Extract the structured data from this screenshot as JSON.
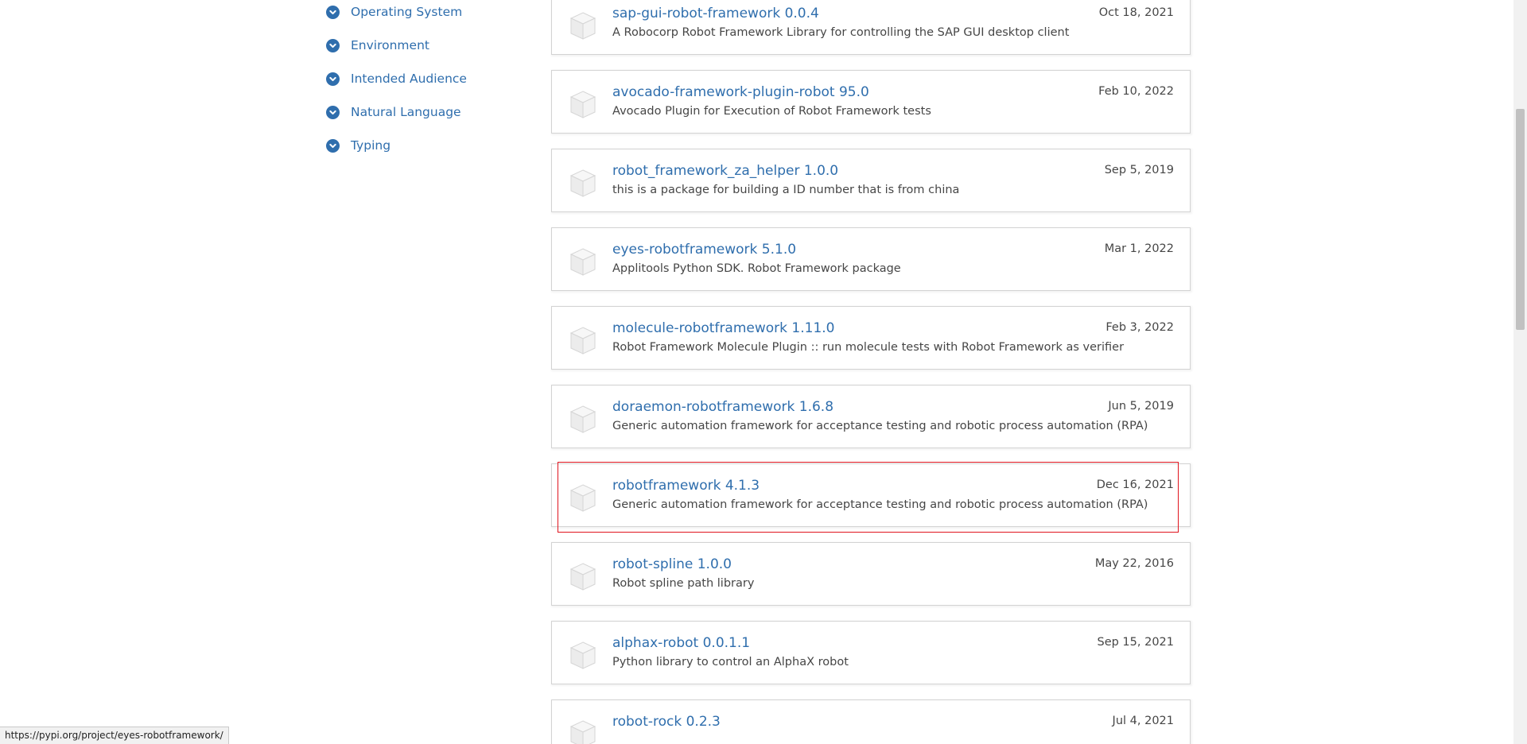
{
  "filters": [
    {
      "label": "Operating System",
      "icon": "chevron-down-circle-icon"
    },
    {
      "label": "Environment",
      "icon": "chevron-down-circle-icon"
    },
    {
      "label": "Intended Audience",
      "icon": "chevron-down-circle-icon"
    },
    {
      "label": "Natural Language",
      "icon": "chevron-down-circle-icon"
    },
    {
      "label": "Typing",
      "icon": "chevron-down-circle-icon"
    }
  ],
  "packages": [
    {
      "name": "sap-gui-robot-framework 0.0.4",
      "description": "A Robocorp Robot Framework Library for controlling the SAP GUI desktop client",
      "date": "Oct 18, 2021"
    },
    {
      "name": "avocado-framework-plugin-robot 95.0",
      "description": "Avocado Plugin for Execution of Robot Framework tests",
      "date": "Feb 10, 2022"
    },
    {
      "name": "robot_framework_za_helper 1.0.0",
      "description": "this is a package for building a ID number that is from china",
      "date": "Sep 5, 2019"
    },
    {
      "name": "eyes-robotframework 5.1.0",
      "description": "Applitools Python SDK. Robot Framework package",
      "date": "Mar 1, 2022"
    },
    {
      "name": "molecule-robotframework 1.11.0",
      "description": "Robot Framework Molecule Plugin :: run molecule tests with Robot Framework as verifier",
      "date": "Feb 3, 2022"
    },
    {
      "name": "doraemon-robotframework 1.6.8",
      "description": "Generic automation framework for acceptance testing and robotic process automation (RPA)",
      "date": "Jun 5, 2019"
    },
    {
      "name": "robotframework 4.1.3",
      "description": "Generic automation framework for acceptance testing and robotic process automation (RPA)",
      "date": "Dec 16, 2021"
    },
    {
      "name": "robot-spline 1.0.0",
      "description": "Robot spline path library",
      "date": "May 22, 2016"
    },
    {
      "name": "alphax-robot 0.0.1.1",
      "description": "Python library to control an AlphaX robot",
      "date": "Sep 15, 2021"
    },
    {
      "name": "robot-rock 0.2.3",
      "description": "",
      "date": "Jul 4, 2021"
    }
  ],
  "package_icon": "package-box-icon",
  "status_bar": {
    "url": "https://pypi.org/project/eyes-robotframework/"
  },
  "colors": {
    "link": "#2f6ead",
    "highlight": "#e0141e"
  }
}
